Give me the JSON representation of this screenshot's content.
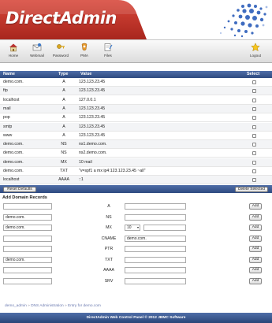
{
  "brand": {
    "logo_text": "DirectAdmin"
  },
  "toolbar": {
    "home": "Home",
    "webmail": "Webmail",
    "password": "Password",
    "phpmyadmin": "PMA",
    "files": "Files",
    "logout": "Logout"
  },
  "table": {
    "headers": {
      "name": "Name",
      "type": "Type",
      "value": "Value",
      "select": "Select"
    },
    "rows": [
      {
        "name": "demo.com.",
        "type": "A",
        "value": "123.123.23.45"
      },
      {
        "name": "ftp",
        "type": "A",
        "value": "123.123.23.45"
      },
      {
        "name": "localhost",
        "type": "A",
        "value": "127.0.0.1"
      },
      {
        "name": "mail",
        "type": "A",
        "value": "123.123.23.45"
      },
      {
        "name": "pop",
        "type": "A",
        "value": "123.123.23.45"
      },
      {
        "name": "smtp",
        "type": "A",
        "value": "123.123.23.45"
      },
      {
        "name": "www",
        "type": "A",
        "value": "123.123.23.45"
      },
      {
        "name": "demo.com.",
        "type": "NS",
        "value": "ns1.demo.com."
      },
      {
        "name": "demo.com.",
        "type": "NS",
        "value": "ns2.demo.com."
      },
      {
        "name": "demo.com.",
        "type": "MX",
        "value": "10 mail"
      },
      {
        "name": "demo.com.",
        "type": "TXT",
        "value": "\"v=spf1 a mx ip4:123.123.23.45 ~all\""
      },
      {
        "name": "localhost",
        "type": "AAAA",
        "value": "::1"
      }
    ],
    "reset_label": "Reset Defaults",
    "delete_label": "Delete Selected"
  },
  "add_records": {
    "title": "Add Domain Records",
    "add_label": "Add",
    "rows": [
      {
        "name": "",
        "type": "A",
        "value": ""
      },
      {
        "name": "demo.com.",
        "type": "NS",
        "value": ""
      },
      {
        "name": "demo.com.",
        "type": "MX",
        "priority": "10",
        "value": ""
      },
      {
        "name": "",
        "type": "CNAME",
        "value": "demo.com."
      },
      {
        "name": "",
        "type": "PTR",
        "value": ""
      },
      {
        "name": "demo.com.",
        "type": "TXT",
        "value": ""
      },
      {
        "name": "",
        "type": "AAAA",
        "value": ""
      },
      {
        "name": "",
        "type": "SRV",
        "value": ""
      }
    ]
  },
  "breadcrumb": {
    "items": [
      "demo_admin",
      "DNS Administration",
      "Entry for demo.com"
    ],
    "separator": "»"
  },
  "footer": {
    "text": "DirectAdmin Web Control Panel © 2012 JBMC Software"
  },
  "colors": {
    "header_blue": "#2e4a80",
    "accent_blue": "#4f6ea8"
  }
}
